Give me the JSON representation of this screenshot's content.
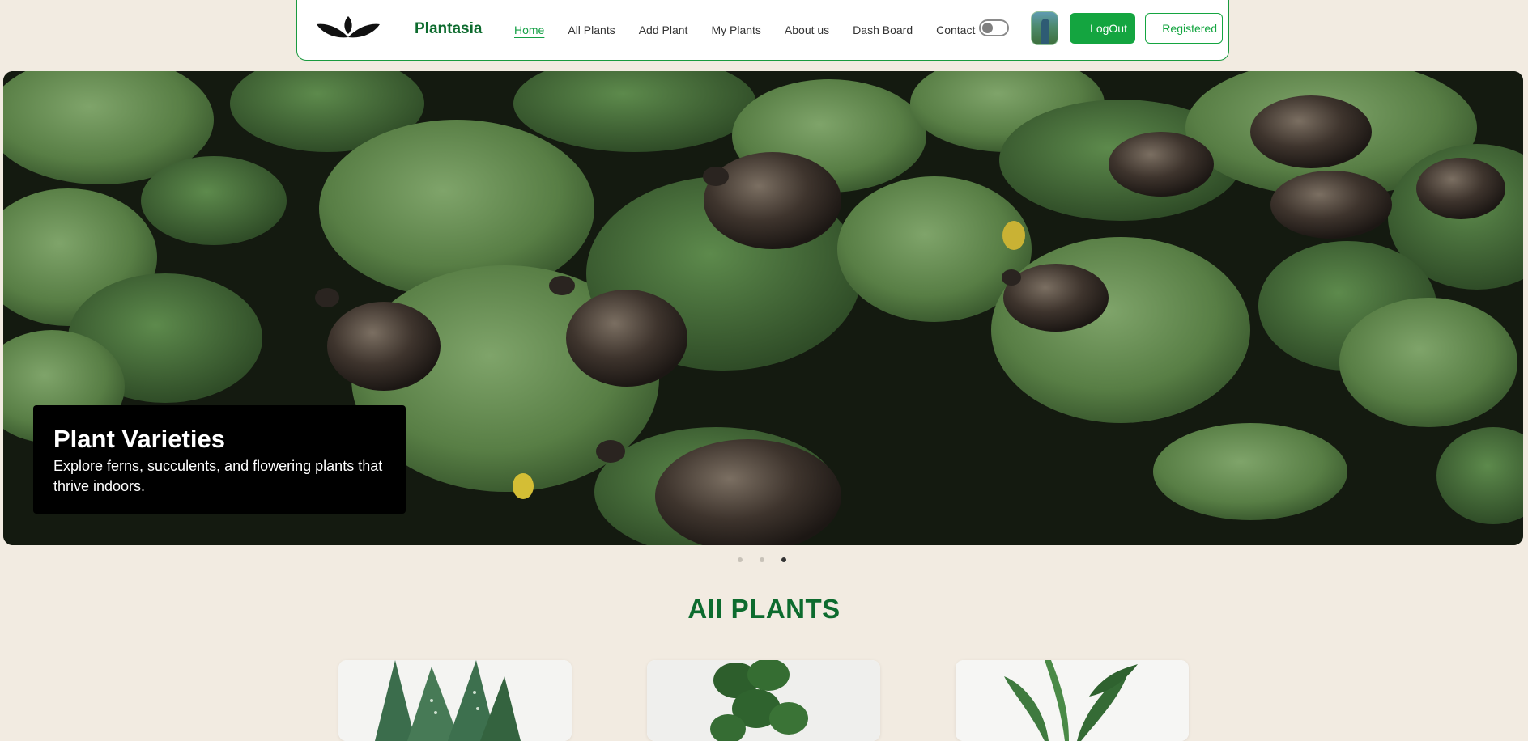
{
  "header": {
    "brand_name": "Plantasia",
    "logo_icon": "leaf-logo-icon",
    "nav": [
      {
        "label": "Home",
        "active": true
      },
      {
        "label": "All Plants",
        "active": false
      },
      {
        "label": "Add Plant",
        "active": false
      },
      {
        "label": "My Plants",
        "active": false
      },
      {
        "label": "About us",
        "active": false
      },
      {
        "label": "Dash Board",
        "active": false
      },
      {
        "label": "Contact",
        "active": false
      }
    ],
    "theme_toggle_on": false,
    "logout_label": "LogOut",
    "registered_label": "Registered"
  },
  "hero": {
    "image_alt": "turtles on lily pads",
    "caption_title": "Plant Varieties",
    "caption_text": "Explore ferns, succulents, and flowering plants that thrive indoors.",
    "slides_total": 3,
    "active_slide": 3
  },
  "section": {
    "title": "All PLANTS"
  },
  "cards": [
    {
      "image": "aloe plant"
    },
    {
      "image": "fiddle leaf fig plant"
    },
    {
      "image": "peace lily plant"
    }
  ],
  "colors": {
    "brand_green": "#14a540",
    "title_green": "#0d6b2e",
    "page_bg": "#f2ebe1"
  }
}
